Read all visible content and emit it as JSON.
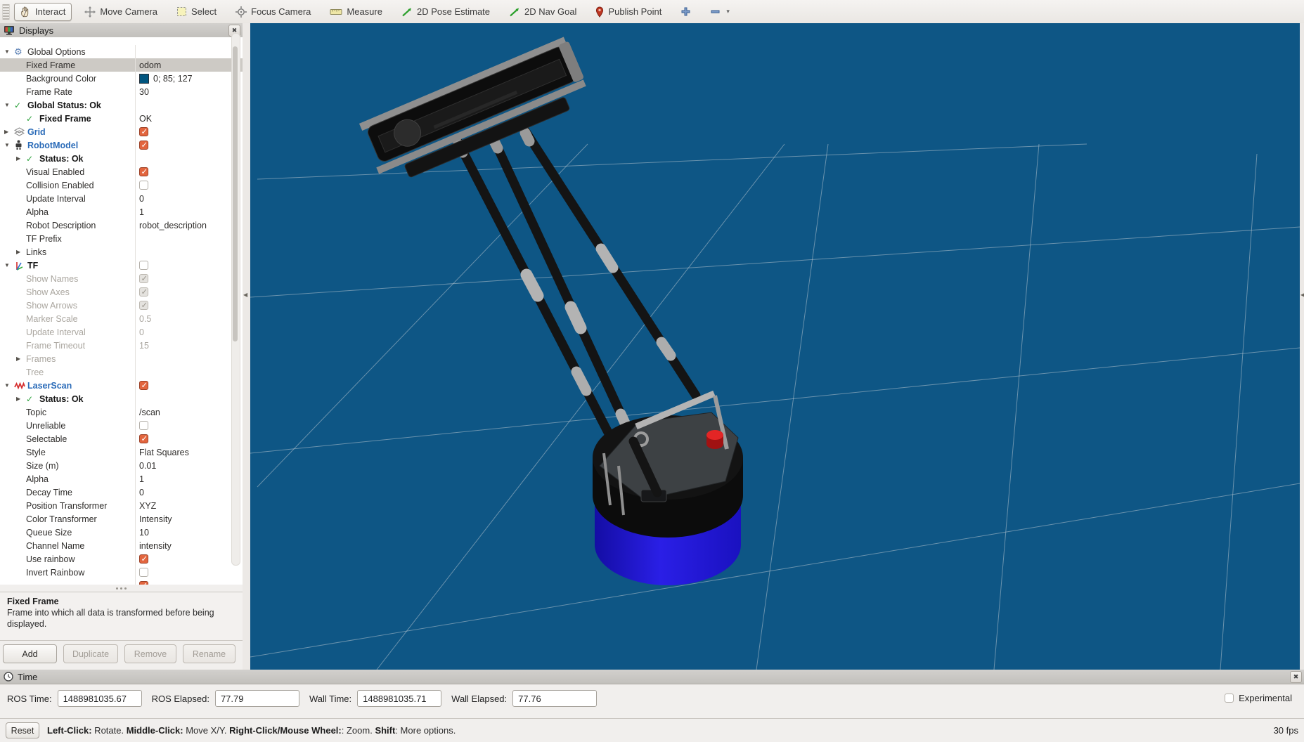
{
  "toolbar": {
    "tools": [
      {
        "label": "Interact",
        "icon": "hand",
        "active": true
      },
      {
        "label": "Move Camera",
        "icon": "move"
      },
      {
        "label": "Select",
        "icon": "select"
      },
      {
        "label": "Focus Camera",
        "icon": "focus"
      },
      {
        "label": "Measure",
        "icon": "measure"
      },
      {
        "label": "2D Pose Estimate",
        "icon": "green-arrow"
      },
      {
        "label": "2D Nav Goal",
        "icon": "green-arrow"
      },
      {
        "label": "Publish Point",
        "icon": "pin"
      },
      {
        "label": "",
        "name": "add-display",
        "icon": "plus"
      },
      {
        "label": "",
        "name": "remove-display",
        "icon": "minus",
        "caret": true
      }
    ]
  },
  "displays_panel": {
    "title": "Displays",
    "rows": [
      {
        "indent": 0,
        "expander": "open",
        "icon": "gear",
        "label": "Global Options",
        "value": null
      },
      {
        "indent": 1,
        "label": "Fixed Frame",
        "selected": true,
        "value": {
          "type": "text",
          "text": "odom"
        }
      },
      {
        "indent": 1,
        "label": "Background Color",
        "value": {
          "type": "color",
          "text": "0; 85; 127",
          "hex": "#00557f"
        }
      },
      {
        "indent": 1,
        "label": "Frame Rate",
        "value": {
          "type": "text",
          "text": "30"
        }
      },
      {
        "indent": 0,
        "expander": "open",
        "icon": "check",
        "label": "Global Status: Ok",
        "style": "status",
        "value": null
      },
      {
        "indent": 1,
        "icon": "check",
        "label": "Fixed Frame",
        "style": "status",
        "value": {
          "type": "text",
          "text": "OK"
        }
      },
      {
        "indent": 0,
        "expander": "closed",
        "icon": "grid",
        "label": "Grid",
        "style": "b-blue",
        "value": {
          "type": "check",
          "checked": true
        }
      },
      {
        "indent": 0,
        "expander": "open",
        "icon": "robot",
        "label": "RobotModel",
        "style": "b-blue",
        "value": {
          "type": "check",
          "checked": true
        }
      },
      {
        "indent": 1,
        "expander": "closed",
        "icon": "check",
        "label": "Status: Ok",
        "style": "status",
        "value": null
      },
      {
        "indent": 1,
        "label": "Visual Enabled",
        "value": {
          "type": "check",
          "checked": true
        }
      },
      {
        "indent": 1,
        "label": "Collision Enabled",
        "value": {
          "type": "check",
          "checked": false
        }
      },
      {
        "indent": 1,
        "label": "Update Interval",
        "value": {
          "type": "text",
          "text": "0"
        }
      },
      {
        "indent": 1,
        "label": "Alpha",
        "value": {
          "type": "text",
          "text": "1"
        }
      },
      {
        "indent": 1,
        "label": "Robot Description",
        "value": {
          "type": "text",
          "text": "robot_description"
        }
      },
      {
        "indent": 1,
        "label": "TF Prefix",
        "value": null
      },
      {
        "indent": 1,
        "expander": "closed",
        "label": "Links",
        "value": null
      },
      {
        "indent": 0,
        "expander": "open",
        "icon": "axes",
        "label": "TF",
        "style": "b-black",
        "value": {
          "type": "check",
          "checked": false
        }
      },
      {
        "indent": 1,
        "label": "Show Names",
        "style": "dis",
        "value": {
          "type": "check",
          "checked": true,
          "disabled": true
        }
      },
      {
        "indent": 1,
        "label": "Show Axes",
        "style": "dis",
        "value": {
          "type": "check",
          "checked": true,
          "disabled": true
        }
      },
      {
        "indent": 1,
        "label": "Show Arrows",
        "style": "dis",
        "value": {
          "type": "check",
          "checked": true,
          "disabled": true
        }
      },
      {
        "indent": 1,
        "label": "Marker Scale",
        "style": "dis",
        "value": {
          "type": "text",
          "text": "0.5",
          "disabled": true
        }
      },
      {
        "indent": 1,
        "label": "Update Interval",
        "style": "dis",
        "value": {
          "type": "text",
          "text": "0",
          "disabled": true
        }
      },
      {
        "indent": 1,
        "label": "Frame Timeout",
        "style": "dis",
        "value": {
          "type": "text",
          "text": "15",
          "disabled": true
        }
      },
      {
        "indent": 1,
        "expander": "closed",
        "label": "Frames",
        "style": "dis",
        "value": null
      },
      {
        "indent": 1,
        "label": "Tree",
        "style": "dis",
        "value": null
      },
      {
        "indent": 0,
        "expander": "open",
        "icon": "laser",
        "label": "LaserScan",
        "style": "b-blue",
        "value": {
          "type": "check",
          "checked": true
        }
      },
      {
        "indent": 1,
        "expander": "closed",
        "icon": "check",
        "label": "Status: Ok",
        "style": "status",
        "value": null
      },
      {
        "indent": 1,
        "label": "Topic",
        "value": {
          "type": "text",
          "text": "/scan"
        }
      },
      {
        "indent": 1,
        "label": "Unreliable",
        "value": {
          "type": "check",
          "checked": false
        }
      },
      {
        "indent": 1,
        "label": "Selectable",
        "value": {
          "type": "check",
          "checked": true
        }
      },
      {
        "indent": 1,
        "label": "Style",
        "value": {
          "type": "text",
          "text": "Flat Squares"
        }
      },
      {
        "indent": 1,
        "label": "Size (m)",
        "value": {
          "type": "text",
          "text": "0.01"
        }
      },
      {
        "indent": 1,
        "label": "Alpha",
        "value": {
          "type": "text",
          "text": "1"
        }
      },
      {
        "indent": 1,
        "label": "Decay Time",
        "value": {
          "type": "text",
          "text": "0"
        }
      },
      {
        "indent": 1,
        "label": "Position Transformer",
        "value": {
          "type": "text",
          "text": "XYZ"
        }
      },
      {
        "indent": 1,
        "label": "Color Transformer",
        "value": {
          "type": "text",
          "text": "Intensity"
        }
      },
      {
        "indent": 1,
        "label": "Queue Size",
        "value": {
          "type": "text",
          "text": "10"
        }
      },
      {
        "indent": 1,
        "label": "Channel Name",
        "value": {
          "type": "text",
          "text": "intensity"
        }
      },
      {
        "indent": 1,
        "label": "Use rainbow",
        "value": {
          "type": "check",
          "checked": true
        }
      },
      {
        "indent": 1,
        "label": "Invert Rainbow",
        "value": {
          "type": "check",
          "checked": false
        }
      },
      {
        "indent": 1,
        "label": "",
        "value": {
          "type": "check",
          "checked": true
        }
      }
    ],
    "help": {
      "title": "Fixed Frame",
      "body": "Frame into which all data is transformed before being displayed."
    },
    "buttons": [
      {
        "label": "Add",
        "enabled": true
      },
      {
        "label": "Duplicate",
        "enabled": false
      },
      {
        "label": "Remove",
        "enabled": false
      },
      {
        "label": "Rename",
        "enabled": false
      }
    ]
  },
  "viewport": {
    "background_color": "#0e5685",
    "grid_color": "#c3ced5",
    "robot_base_color": "#1c13cc",
    "robot_button_color": "#d21f1f",
    "robot_body_color": "#141414"
  },
  "time_panel": {
    "title": "Time",
    "fields": [
      {
        "label": "ROS Time:",
        "value": "1488981035.67"
      },
      {
        "label": "ROS Elapsed:",
        "value": "77.79"
      },
      {
        "label": "Wall Time:",
        "value": "1488981035.71"
      },
      {
        "label": "Wall Elapsed:",
        "value": "77.76"
      }
    ],
    "experimental_label": "Experimental",
    "experimental_checked": false
  },
  "status_bar": {
    "reset_label": "Reset",
    "segments": [
      [
        "Left-Click:",
        " Rotate.  "
      ],
      [
        "Middle-Click:",
        " Move X/Y.  "
      ],
      [
        "Right-Click/Mouse Wheel:",
        ": Zoom.  "
      ],
      [
        "Shift",
        ": More options."
      ]
    ],
    "fps": "30 fps"
  }
}
